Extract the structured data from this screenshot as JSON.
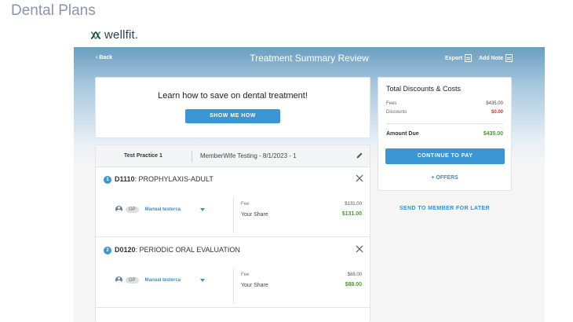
{
  "slide": {
    "title": "Dental Plans"
  },
  "brand": {
    "name": "wellfit."
  },
  "topbar": {
    "back_label": "Back",
    "title": "Treatment Summary Review",
    "export_label": "Export",
    "add_note_label": "Add Note"
  },
  "promo": {
    "text": "Learn how to save on dental treatment!",
    "button_label": "SHOW ME HOW"
  },
  "summary": {
    "title": "Total Discounts & Costs",
    "fees_label": "Fees",
    "fees_value": "$435.00",
    "discounts_label": "Discounts",
    "discounts_value": "$0.00",
    "amount_due_label": "Amount Due",
    "amount_due_value": "$435.00",
    "continue_label": "CONTINUE TO PAY",
    "offers_label": "+ OFFERS"
  },
  "send_label": "SEND TO MEMBER FOR LATER",
  "treatment": {
    "practice": "Test Practice 1",
    "member": "MemberWife Testing - 8/1/2023 - 1",
    "items": [
      {
        "number": "1",
        "code": "D1110",
        "description": ": PROPHYLAXIS-ADULT",
        "provider_type": "GP",
        "provider": "Manual testerca",
        "fee_label": "Fee",
        "fee": "$131.00",
        "share_label": "Your Share",
        "share": "$131.00"
      },
      {
        "number": "2",
        "code": "D0120",
        "description": ": PERIODIC ORAL EVALUATION",
        "provider_type": "GP",
        "provider": "Manual testerca",
        "fee_label": "Fee",
        "fee": "$88.00",
        "share_label": "Your Share",
        "share": "$88.00"
      }
    ]
  },
  "colors": {
    "accent": "#3b96d6",
    "header_top": "#6a9fc1",
    "discount_red": "#c0392b",
    "share_green": "#4a9a2a"
  },
  "icons": [
    "wellfit-logo-icon",
    "chevron-left-icon",
    "export-icon",
    "note-icon",
    "pencil-icon",
    "close-icon",
    "avatar-icon",
    "chevron-down-icon"
  ]
}
